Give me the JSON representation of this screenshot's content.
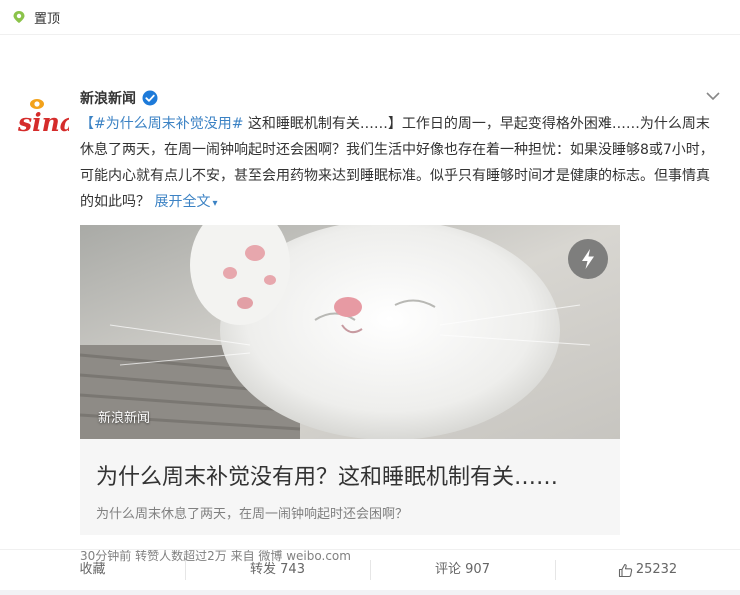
{
  "pin": {
    "label": "置顶"
  },
  "author": {
    "name": "新浪新闻"
  },
  "post": {
    "hashtag": "【#为什么周末补觉没用#",
    "body": " 这和睡眠机制有关……】工作日的周一，早起变得格外困难……为什么周末休息了两天，在周一闹钟响起时还会困啊？我们生活中好像也存在着一种担忧：如果没睡够8或7小时，可能内心就有点儿不安，甚至会用药物来达到睡眠标准。似乎只有睡够时间才是健康的标志。但事情真的如此吗？ ",
    "expand": "展开全文"
  },
  "media": {
    "watermark": "新浪新闻",
    "title": "为什么周末补觉没有用？这和睡眠机制有关……",
    "subtitle": "为什么周末休息了两天，在周一闹钟响起时还会困啊？"
  },
  "meta": {
    "time": "30分钟前",
    "reposts_note": "转赞人数超过2万",
    "source_prefix": "来自",
    "source": "微博 weibo.com"
  },
  "actions": {
    "favorite": "收藏",
    "repost": "转发 743",
    "comment": "评论 907",
    "like": "25232"
  },
  "colors": {
    "link": "#3b82c4",
    "verified": "#1d7ad9",
    "pin": "#8bc34a",
    "sina_red": "#d52c2b"
  }
}
